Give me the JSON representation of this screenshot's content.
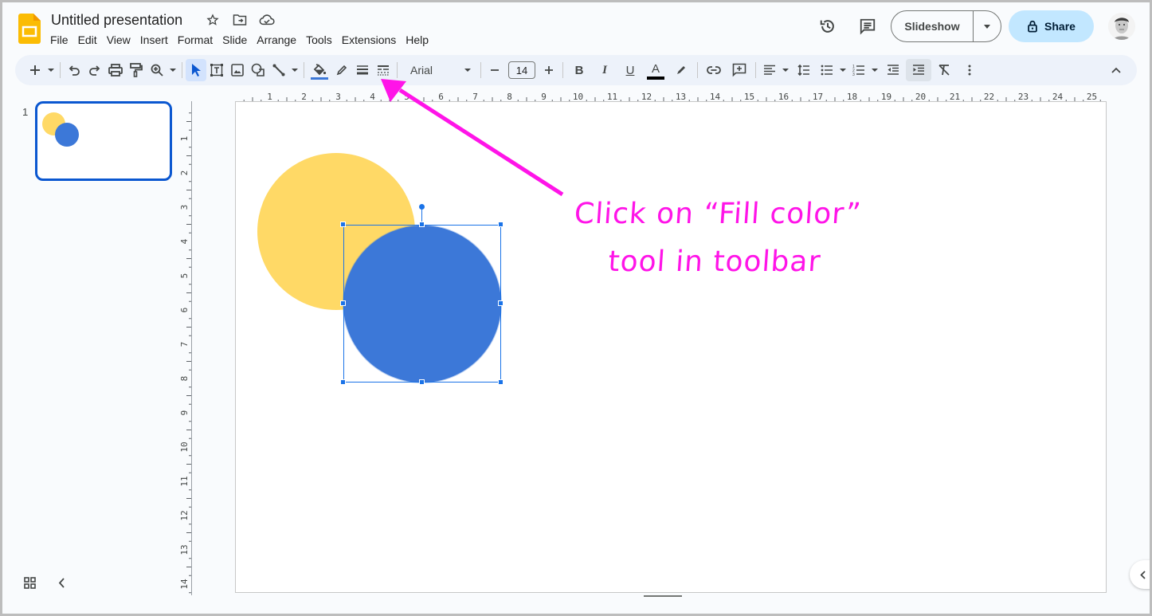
{
  "app": {
    "title": "Untitled presentation",
    "menu": [
      "File",
      "Edit",
      "View",
      "Insert",
      "Format",
      "Slide",
      "Arrange",
      "Tools",
      "Extensions",
      "Help"
    ],
    "slideshow_label": "Slideshow",
    "share_label": "Share",
    "brand_color": "#fbbc04"
  },
  "toolbar": {
    "font": "Arial",
    "font_size": "14",
    "bold": "B",
    "italic": "I",
    "underline": "U",
    "text_color_glyph": "A",
    "fill_color": "#3c78d8",
    "text_color": "#000000"
  },
  "rulers": {
    "horizontal": [
      "1",
      "2",
      "3",
      "4",
      "5",
      "6",
      "7",
      "8",
      "9",
      "10",
      "11",
      "12",
      "13",
      "14",
      "15",
      "16",
      "17",
      "18",
      "19",
      "20",
      "21",
      "22",
      "23",
      "24",
      "25"
    ],
    "vertical": [
      "1",
      "2",
      "3",
      "4",
      "5",
      "6",
      "7",
      "8",
      "9",
      "10",
      "11",
      "12",
      "13",
      "14"
    ]
  },
  "filmstrip": {
    "slides": [
      {
        "number": "1"
      }
    ]
  },
  "slide": {
    "shapes": [
      {
        "name": "yellow-circle",
        "color": "#ffd966"
      },
      {
        "name": "blue-circle",
        "color": "#3c78d8",
        "selected": true
      }
    ]
  },
  "annotation": {
    "line1": "Click on “Fill color”",
    "line2": "tool in toolbar",
    "color": "#ff14e8"
  }
}
